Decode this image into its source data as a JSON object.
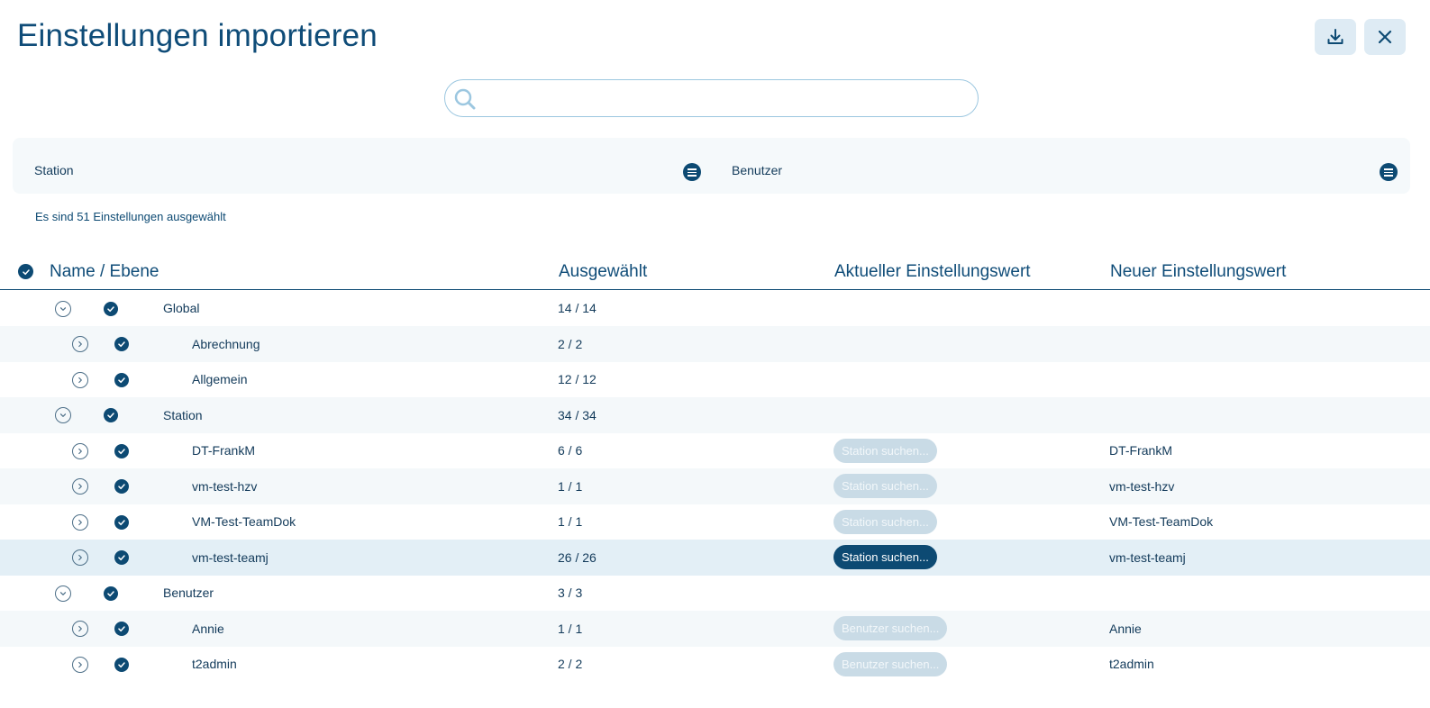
{
  "header": {
    "title": "Einstellungen importieren"
  },
  "search": {
    "value": "",
    "placeholder": ""
  },
  "filters": {
    "station_label": "Station",
    "user_label": "Benutzer"
  },
  "summary": "Es sind 51 Einstellungen ausgewählt",
  "table": {
    "columns": [
      "Name / Ebene",
      "Ausgewählt",
      "Aktueller Einstellungswert",
      "Neuer Einstellungswert"
    ],
    "rows": [
      {
        "name": "Global",
        "selected": "14 / 14",
        "current": "",
        "new": "",
        "level": 0,
        "expanded": true
      },
      {
        "name": "Abrechnung",
        "selected": "2 / 2",
        "current": "",
        "new": "",
        "level": 1,
        "expanded": false
      },
      {
        "name": "Allgemein",
        "selected": "12 / 12",
        "current": "",
        "new": "",
        "level": 1,
        "expanded": false
      },
      {
        "name": "Station",
        "selected": "34 / 34",
        "current": "",
        "new": "",
        "level": 0,
        "expanded": true
      },
      {
        "name": "DT-FrankM",
        "selected": "6 / 6",
        "current": "Station suchen...",
        "new": "DT-FrankM",
        "level": 1,
        "expanded": false
      },
      {
        "name": "vm-test-hzv",
        "selected": "1 / 1",
        "current": "Station suchen...",
        "new": "vm-test-hzv",
        "level": 1,
        "expanded": false
      },
      {
        "name": "VM-Test-TeamDok",
        "selected": "1 / 1",
        "current": "Station suchen...",
        "new": "VM-Test-TeamDok",
        "level": 1,
        "expanded": false
      },
      {
        "name": "vm-test-teamj",
        "selected": "26 / 26",
        "current": "Station suchen...",
        "new": "vm-test-teamj",
        "level": 1,
        "expanded": false
      },
      {
        "name": "Benutzer",
        "selected": "3 / 3",
        "current": "",
        "new": "",
        "level": 0,
        "expanded": true
      },
      {
        "name": "Annie",
        "selected": "1 / 1",
        "current": "Benutzer suchen...",
        "new": "Annie",
        "level": 1,
        "expanded": false
      },
      {
        "name": "t2admin",
        "selected": "2 / 2",
        "current": "Benutzer suchen...",
        "new": "t2admin",
        "level": 1,
        "expanded": false
      }
    ]
  },
  "colors": {
    "primary": "#0d4a73",
    "row_alt": "#f4f8fa",
    "row_highlight": "#e3eff6",
    "pill_inactive": "#c9dbe6"
  },
  "icons": [
    "download-icon",
    "close-icon",
    "search-icon",
    "menu-icon",
    "check-circle-icon",
    "chevron-down-icon",
    "chevron-right-icon"
  ]
}
